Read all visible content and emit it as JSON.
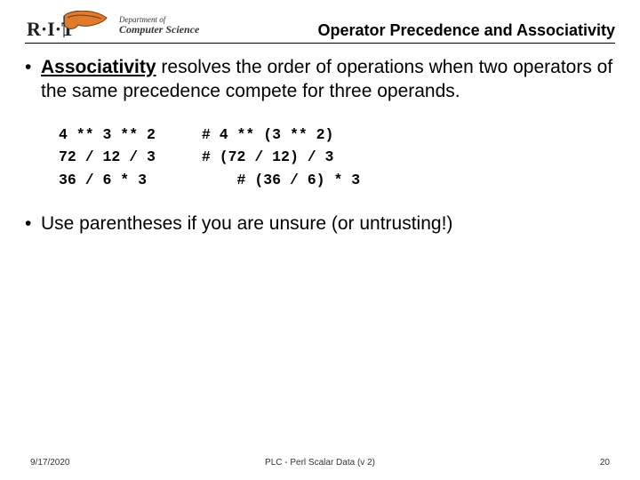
{
  "header": {
    "dept_of": "Department of",
    "cs": "Computer Science",
    "title": "Operator Precedence and Associativity"
  },
  "bullets": {
    "b1_term": "Associativity",
    "b1_rest": " resolves the order of operations when two operators of the same precedence compete for three operands.",
    "b2": "Use parentheses if you are unsure (or untrusting!)"
  },
  "code": {
    "left": "4 ** 3 ** 2\n72 / 12 / 3\n36 / 6 * 3",
    "right": "# 4 ** (3 ** 2)\n# (72 / 12) / 3\n    # (36 / 6) * 3"
  },
  "footer": {
    "date": "9/17/2020",
    "center": "PLC - Perl Scalar Data (v 2)",
    "page": "20"
  }
}
